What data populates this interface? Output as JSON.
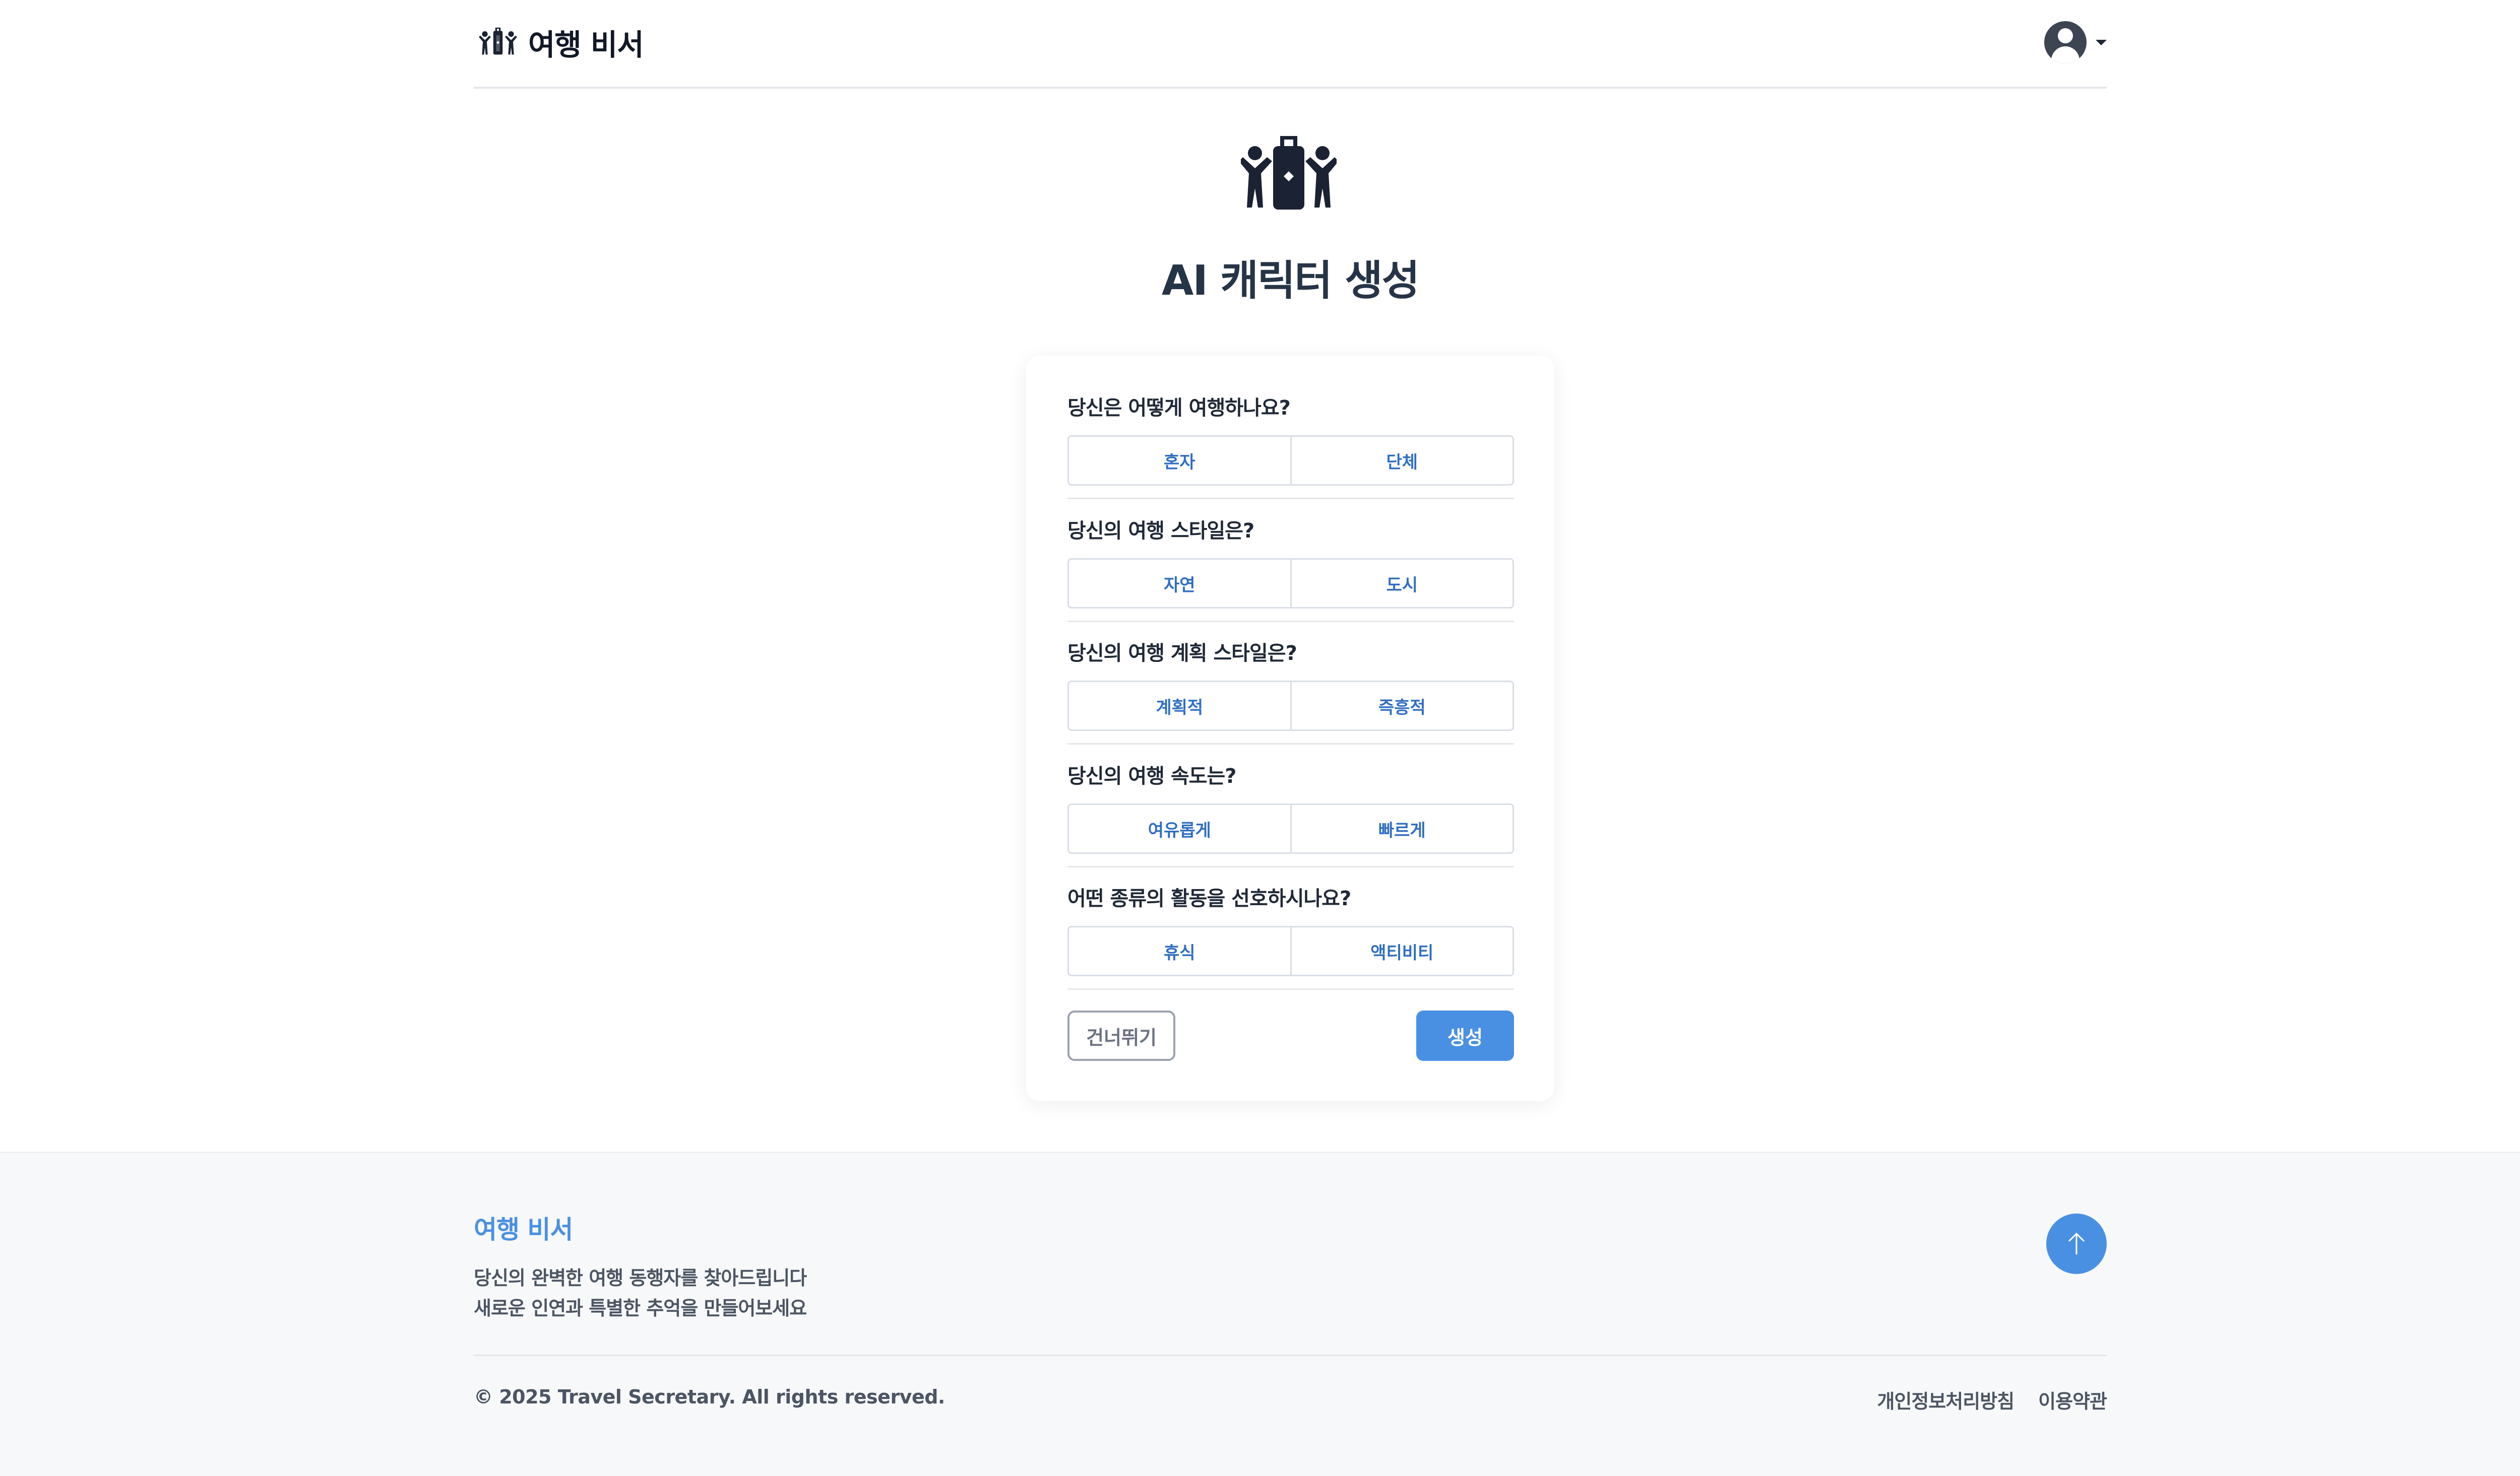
{
  "header": {
    "brand_name": "여행 비서",
    "logo_icon": "travel-friends-suitcase-icon",
    "profile_icon": "user-avatar-icon"
  },
  "main": {
    "title": "AI 캐릭터 생성",
    "questions": [
      {
        "label": "당신은 어떻게 여행하나요?",
        "options": [
          "혼자",
          "단체"
        ]
      },
      {
        "label": "당신의 여행 스타일은?",
        "options": [
          "자연",
          "도시"
        ]
      },
      {
        "label": "당신의 여행 계획 스타일은?",
        "options": [
          "계획적",
          "즉흥적"
        ]
      },
      {
        "label": "당신의 여행 속도는?",
        "options": [
          "여유롭게",
          "빠르게"
        ]
      },
      {
        "label": "어떤 종류의 활동을 선호하시나요?",
        "options": [
          "휴식",
          "액티비티"
        ]
      }
    ],
    "skip_label": "건너뛰기",
    "create_label": "생성"
  },
  "footer": {
    "brand": "여행 비서",
    "desc_line1": "당신의 완벽한 여행 동행자를 찾아드립니다",
    "desc_line2": "새로운 인연과 특별한 추억을 만들어보세요",
    "copyright": "© 2025 Travel Secretary. All rights reserved.",
    "links": [
      "개인정보처리방침",
      "이용약관"
    ]
  },
  "colors": {
    "accent": "#4a90e2",
    "option_text": "#2f6ec2",
    "title": "#263447"
  }
}
